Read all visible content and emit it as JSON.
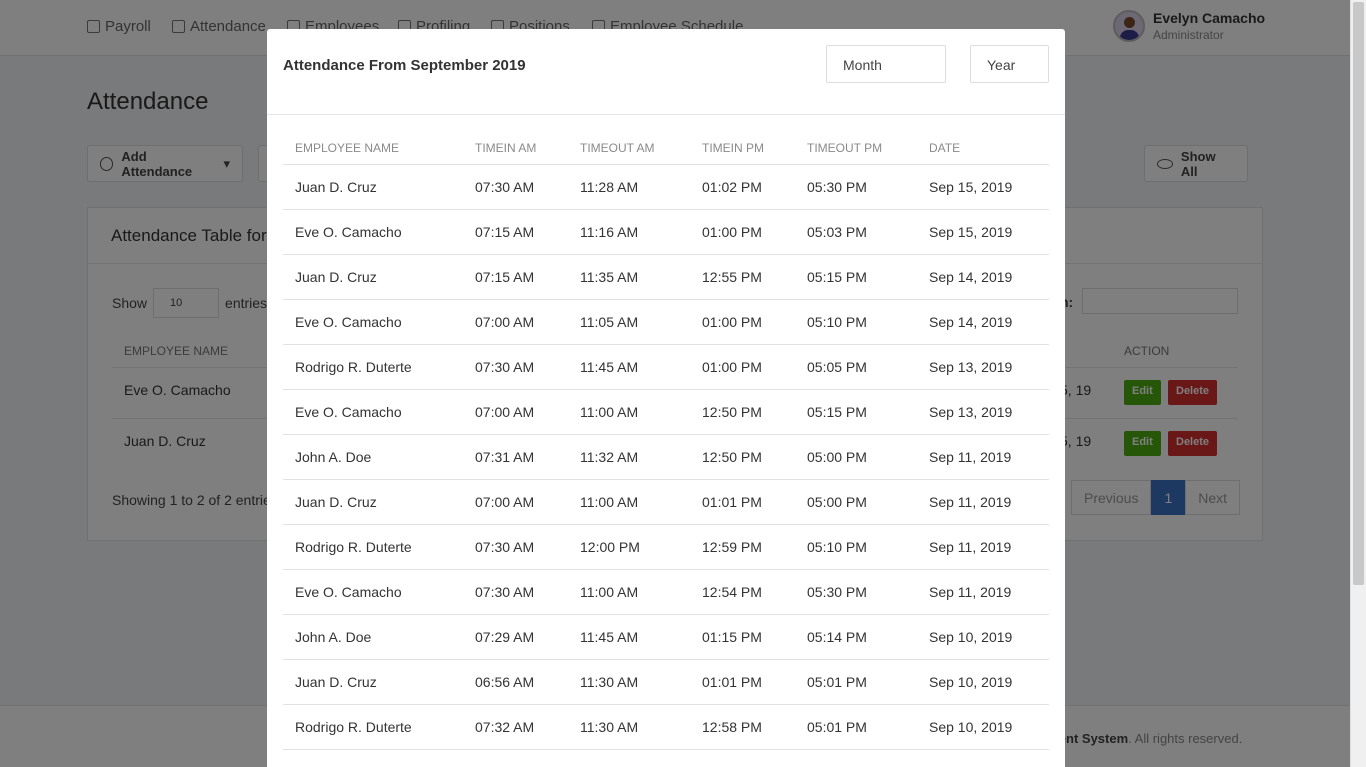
{
  "nav": {
    "items": [
      {
        "label": "Payroll",
        "icon": "home-icon"
      },
      {
        "label": "Attendance",
        "icon": "calendar-icon"
      },
      {
        "label": "Employees",
        "icon": "users-icon"
      },
      {
        "label": "Profiling",
        "icon": "user-icon"
      },
      {
        "label": "Positions",
        "icon": "list-icon"
      },
      {
        "label": "Employee Schedule",
        "icon": "folder-icon"
      }
    ],
    "user_name": "Evelyn Camacho",
    "user_role": "Administrator"
  },
  "page": {
    "title": "Attendance",
    "add_attendance_label": "Add Attendance",
    "show_all_label": "Show All",
    "card_title": "Attendance Table for",
    "show_label": "Show",
    "entries_value": "10",
    "entries_label": "entries",
    "search_label": "h:",
    "col_employee": "EMPLOYEE NAME",
    "col_action": "ACTION",
    "rows": [
      {
        "name": "Eve O. Camacho",
        "date": "5, 19"
      },
      {
        "name": "Juan D. Cruz",
        "date": "5, 19"
      }
    ],
    "edit_label": "Edit",
    "delete_label": "Delete",
    "showing_text": "Showing 1 to 2 of 2 entrie",
    "pager_prev": "Previous",
    "pager_page": "1",
    "pager_next": "Next",
    "footer_bold": "ement System",
    "footer_rest": ". All rights reserved."
  },
  "modal": {
    "title": "Attendance From September 2019",
    "month_placeholder": "Month",
    "year_placeholder": "Year",
    "columns": [
      "EMPLOYEE NAME",
      "TIMEIN AM",
      "TIMEOUT AM",
      "TIMEIN PM",
      "TIMEOUT PM",
      "DATE"
    ],
    "rows": [
      [
        "Juan D. Cruz",
        "07:30 AM",
        "11:28 AM",
        "01:02 PM",
        "05:30 PM",
        "Sep 15, 2019"
      ],
      [
        "Eve O. Camacho",
        "07:15 AM",
        "11:16 AM",
        "01:00 PM",
        "05:03 PM",
        "Sep 15, 2019"
      ],
      [
        "Juan D. Cruz",
        "07:15 AM",
        "11:35 AM",
        "12:55 PM",
        "05:15 PM",
        "Sep 14, 2019"
      ],
      [
        "Eve O. Camacho",
        "07:00 AM",
        "11:05 AM",
        "01:00 PM",
        "05:10 PM",
        "Sep 14, 2019"
      ],
      [
        "Rodrigo R. Duterte",
        "07:30 AM",
        "11:45 AM",
        "01:00 PM",
        "05:05 PM",
        "Sep 13, 2019"
      ],
      [
        "Eve O. Camacho",
        "07:00 AM",
        "11:00 AM",
        "12:50 PM",
        "05:15 PM",
        "Sep 13, 2019"
      ],
      [
        "John A. Doe",
        "07:31 AM",
        "11:32 AM",
        "12:50 PM",
        "05:00 PM",
        "Sep 11, 2019"
      ],
      [
        "Juan D. Cruz",
        "07:00 AM",
        "11:00 AM",
        "01:01 PM",
        "05:00 PM",
        "Sep 11, 2019"
      ],
      [
        "Rodrigo R. Duterte",
        "07:30 AM",
        "12:00 PM",
        "12:59 PM",
        "05:10 PM",
        "Sep 11, 2019"
      ],
      [
        "Eve O. Camacho",
        "07:30 AM",
        "11:00 AM",
        "12:54 PM",
        "05:30 PM",
        "Sep 11, 2019"
      ],
      [
        "John A. Doe",
        "07:29 AM",
        "11:45 AM",
        "01:15 PM",
        "05:14 PM",
        "Sep 10, 2019"
      ],
      [
        "Juan D. Cruz",
        "06:56 AM",
        "11:30 AM",
        "01:01 PM",
        "05:01 PM",
        "Sep 10, 2019"
      ],
      [
        "Rodrigo R. Duterte",
        "07:32 AM",
        "11:30 AM",
        "12:58 PM",
        "05:01 PM",
        "Sep 10, 2019"
      ]
    ]
  }
}
